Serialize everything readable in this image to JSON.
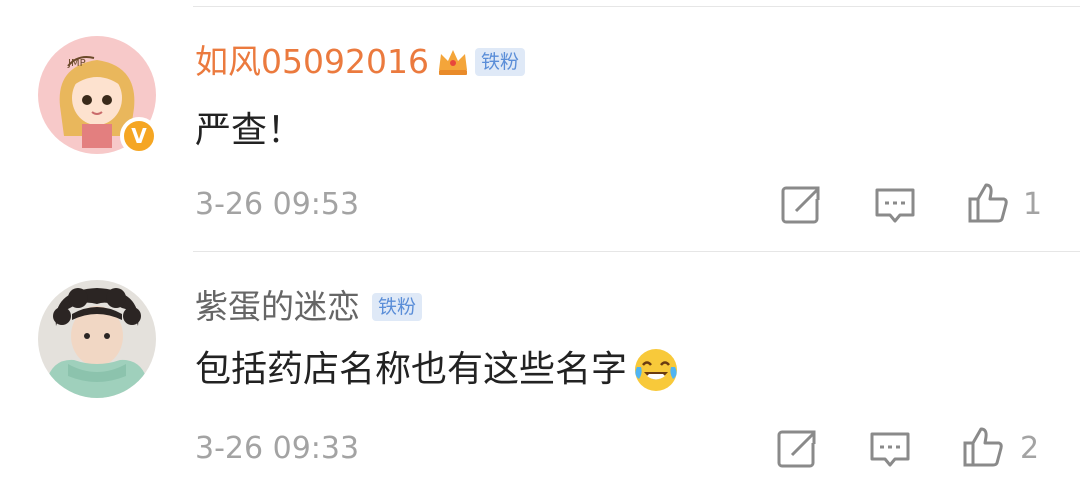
{
  "comments": [
    {
      "username": "如风05092016",
      "fan_badge": "铁粉",
      "verified_badge": "V",
      "content": "严查！",
      "time": "3-26 09:53",
      "likes": "1",
      "icons": [
        "crown-icon",
        "repost-icon",
        "comment-icon",
        "like-icon"
      ],
      "username_color": "#eb7a3e"
    },
    {
      "username": "紫蛋的迷恋",
      "fan_badge": "铁粉",
      "content": "包括药店名称也有这些名字",
      "time": "3-26 09:33",
      "likes": "2",
      "icons": [
        "laugh-cry-emoji-icon",
        "repost-icon",
        "comment-icon",
        "like-icon"
      ],
      "username_color": "#666666"
    }
  ],
  "colors": {
    "fan_badge_bg": "#dfe9f7",
    "fan_badge_text": "#5b8ed8",
    "verified_badge": "#f5a623",
    "meta_text": "#a3a3a3"
  }
}
